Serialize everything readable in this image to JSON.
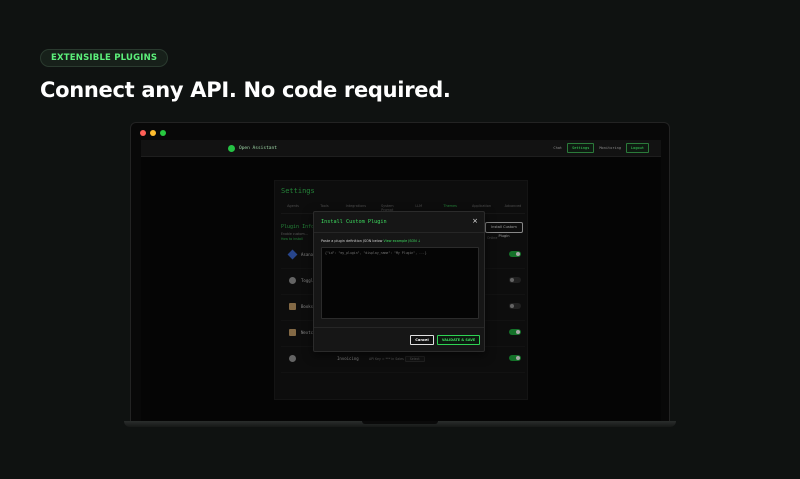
{
  "hero": {
    "badge": "EXTENSIBLE PLUGINS",
    "headline": "Connect any API. No code required."
  },
  "app": {
    "brand": "Open Assistant",
    "nav": [
      "Chat",
      "Settings",
      "Monitoring",
      "Logout"
    ],
    "active_nav": "Settings"
  },
  "settings": {
    "title": "Settings",
    "tabs": [
      "Agents",
      "Tools",
      "Integrations",
      "System Prompt",
      "LLM",
      "Themes",
      "Application",
      "Advanced"
    ],
    "active_tab": "Themes",
    "section_title": "Plugin Info",
    "section_sub": "Enable custom…",
    "section_link": "How to install",
    "install_button": "Install Custom Plugin",
    "online_label": "Online",
    "plugins": [
      {
        "name": "Asana",
        "icon": "diamond-icon",
        "enabled": true,
        "extra": ""
      },
      {
        "name": "Toggl",
        "icon": "clock-icon",
        "enabled": false,
        "extra": ""
      },
      {
        "name": "Bookstack",
        "icon": "document-icon",
        "enabled": false,
        "extra": ""
      },
      {
        "name": "Nextcloud",
        "icon": "document-icon",
        "enabled": true,
        "extra": ""
      },
      {
        "name": "Invoicing",
        "icon": "clock-icon",
        "enabled": true,
        "extra": "API Key = ***  in Sales",
        "select": "Select"
      }
    ]
  },
  "modal": {
    "title": "Install Custom Plugin",
    "close": "×",
    "label": "Paste a plugin definition JSON below",
    "label_link": "View example JSON ↓",
    "placeholder": "{\"id\": \"my_plugin\", \"display_name\": \"My Plugin\", ...}",
    "cancel": "Cancel",
    "validate": "VALIDATE & SAVE"
  },
  "colors": {
    "accent": "#3ddc5f",
    "background": "#0f1211"
  }
}
